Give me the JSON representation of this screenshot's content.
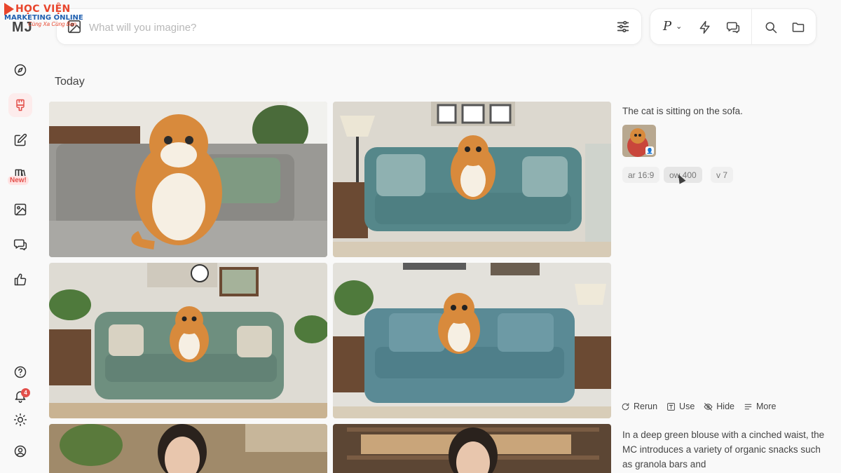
{
  "watermark": {
    "line1": "HỌC VIỆN",
    "line2": "MARKETING ONLINE",
    "line3": "Cùng Xa Cùng Bạn"
  },
  "app_logo": "MJ",
  "sidebar": {
    "items": [
      {
        "name": "explore",
        "icon": "compass-icon"
      },
      {
        "name": "create",
        "icon": "paintbrush-icon",
        "active": true
      },
      {
        "name": "edit",
        "icon": "edit-icon"
      },
      {
        "name": "personalize",
        "icon": "books-icon",
        "badge": "New!"
      },
      {
        "name": "organize",
        "icon": "image-icon"
      },
      {
        "name": "chat",
        "icon": "chat-icon"
      },
      {
        "name": "rank",
        "icon": "thumbs-up-icon"
      }
    ],
    "bottom": [
      {
        "name": "help",
        "icon": "help-icon"
      },
      {
        "name": "notifications",
        "icon": "bell-icon",
        "count": "4"
      },
      {
        "name": "theme",
        "icon": "sun-icon"
      },
      {
        "name": "account",
        "icon": "user-icon"
      }
    ]
  },
  "prompt_bar": {
    "placeholder": "What will you imagine?"
  },
  "tool_bar": {
    "profile_label": "P"
  },
  "section": {
    "title": "Today"
  },
  "job1": {
    "prompt": "The cat is sitting on the sofa.",
    "tags": [
      "ar 16:9",
      "ow 400",
      "v 7"
    ]
  },
  "actions": {
    "rerun": "Rerun",
    "use": "Use",
    "hide": "Hide",
    "more": "More"
  },
  "job2": {
    "prompt": "In a deep green blouse with a cinched waist, the MC introduces a variety of organic snacks such as granola bars and"
  },
  "colors": {
    "accent": "#e3504b",
    "background": "#f9f9f9"
  }
}
